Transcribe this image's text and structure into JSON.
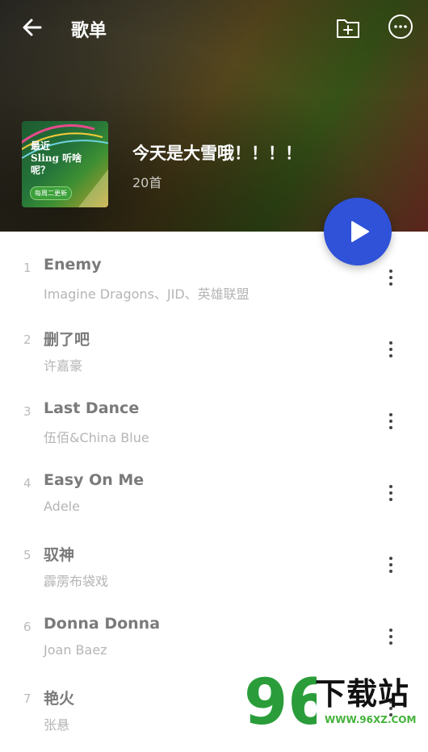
{
  "header": {
    "title": "歌单",
    "playlist_name": "今天是大雪哦！！！！",
    "song_count": "20首",
    "cover_text_line1": "最近",
    "cover_text_line2": "Sling  听啥",
    "cover_text_line3": "呢？",
    "cover_tag": "每周二更新"
  },
  "colors": {
    "play_button": "#2f52d9",
    "watermark_green": "#44b23a"
  },
  "songs": [
    {
      "num": "1",
      "title": "Enemy",
      "artist": "Imagine Dragons、JID、英雄联盟"
    },
    {
      "num": "2",
      "title": "删了吧",
      "artist": "许嘉豪"
    },
    {
      "num": "3",
      "title": "Last Dance",
      "artist": "伍佰&China Blue"
    },
    {
      "num": "4",
      "title": "Easy On Me",
      "artist": "Adele"
    },
    {
      "num": "5",
      "title": "驭神",
      "artist": "霹雳布袋戏"
    },
    {
      "num": "6",
      "title": "Donna Donna",
      "artist": "Joan Baez"
    },
    {
      "num": "7",
      "title": "艳火",
      "artist": "张悬"
    }
  ],
  "watermark": {
    "logo_number": "96",
    "site_name": "下载站",
    "url": "WWW.96XZ.COM"
  },
  "icons": {
    "back": "back-arrow-icon",
    "add_folder": "add-folder-icon",
    "more": "more-options-icon",
    "play": "play-icon",
    "song_menu": "kebab-menu-icon"
  }
}
